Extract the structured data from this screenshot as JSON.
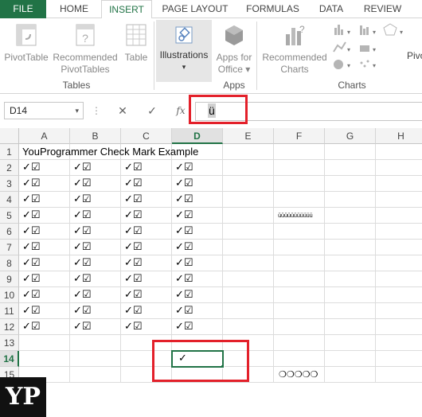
{
  "tabs": [
    "FILE",
    "HOME",
    "INSERT",
    "PAGE LAYOUT",
    "FORMULAS",
    "DATA",
    "REVIEW"
  ],
  "ribbon": {
    "pivottable": "PivotTable",
    "recommended_pivot": [
      "Recommended",
      "PivotTables"
    ],
    "table": "Table",
    "tables_group": "Tables",
    "illustrations": "Illustrations",
    "apps_for_office": [
      "Apps for",
      "Office"
    ],
    "apps_group": "Apps",
    "recommended_charts": [
      "Recommended",
      "Charts"
    ],
    "charts_group": "Charts",
    "pivot_partial": "Pivo"
  },
  "formula_bar": {
    "name_box": "D14",
    "fx": "fx",
    "cancel": "✕",
    "enter": "✓",
    "value": "ü"
  },
  "columns": [
    "A",
    "B",
    "C",
    "D",
    "E",
    "F",
    "G",
    "H"
  ],
  "rows": [
    "1",
    "2",
    "3",
    "4",
    "5",
    "6",
    "7",
    "8",
    "9",
    "10",
    "11",
    "12",
    "13",
    "14",
    "15"
  ],
  "cells": {
    "title": "YouProgrammer Check Mark Example",
    "check_pair": "✓☑",
    "d14": "✓",
    "f5": "üüüüüüüüüüü",
    "f15": "❍❍❍❍❍"
  },
  "selection": {
    "column": "D",
    "row": "14"
  },
  "logo": "YP",
  "colors": {
    "excel_green": "#217346",
    "highlight_red": "#e3202a"
  }
}
